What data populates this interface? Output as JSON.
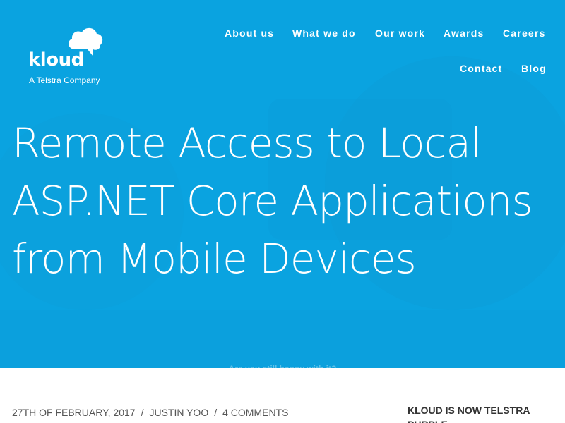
{
  "brand": {
    "name": "kloud",
    "tagline": "A Telstra Company",
    "icon": "cloud-speech-icon"
  },
  "nav": {
    "items": [
      "About us",
      "What we do",
      "Our work",
      "Awards",
      "Careers",
      "Contact",
      "Blog"
    ]
  },
  "post": {
    "title": "Remote Access to Local ASP.NET Core Applications from Mobile Devices",
    "date": "27TH OF FEBRUARY, 2017",
    "separator": "/",
    "author": "JUSTIN YOO",
    "comments": "4 COMMENTS"
  },
  "sidebar": {
    "heading": "KLOUD IS NOW TELSTRA PURPLE"
  },
  "cookie_banner": {
    "question": "Are you still happy with it?"
  },
  "colors": {
    "hero": "#0aa3e0",
    "text_light": "#ffffff",
    "meta_text": "#555555",
    "sidebar_heading": "#333333"
  }
}
